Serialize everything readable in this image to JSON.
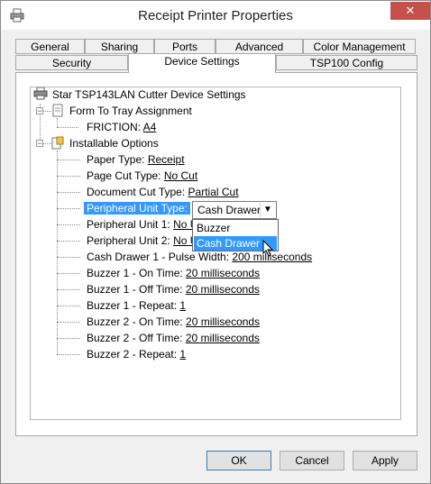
{
  "window": {
    "title": "Receipt Printer Properties",
    "close_label": "✕",
    "icon": "printer-icon"
  },
  "tabs_row1": [
    {
      "label": "General"
    },
    {
      "label": "Sharing"
    },
    {
      "label": "Ports"
    },
    {
      "label": "Advanced"
    },
    {
      "label": "Color Management"
    }
  ],
  "tabs_row2": [
    {
      "label": "Security"
    },
    {
      "label": "Device Settings",
      "selected": true
    },
    {
      "label": "TSP100 Config"
    }
  ],
  "tree": {
    "root": "Star TSP143LAN Cutter Device Settings",
    "form_tray": "Form To Tray Assignment",
    "friction_label": "FRICTION:",
    "friction_value": "A4",
    "installable": "Installable Options",
    "options": [
      {
        "label": "Paper Type:",
        "value": "Receipt"
      },
      {
        "label": "Page Cut Type:",
        "value": "No Cut"
      },
      {
        "label": "Document Cut Type:",
        "value": "Partial Cut"
      },
      {
        "label": "Peripheral Unit Type:",
        "value": ""
      },
      {
        "label": "Peripheral Unit 1:",
        "value": "No U"
      },
      {
        "label": "Peripheral Unit 2:",
        "value": "No U"
      },
      {
        "label": "Cash Drawer 1 - Pulse Width:",
        "value": "200 milliseconds"
      },
      {
        "label": "Buzzer 1 - On Time:",
        "value": "20 milliseconds"
      },
      {
        "label": "Buzzer 1 - Off Time:",
        "value": "20 milliseconds"
      },
      {
        "label": "Buzzer 1 - Repeat:",
        "value": "1"
      },
      {
        "label": "Buzzer 2 - On Time:",
        "value": "20 milliseconds"
      },
      {
        "label": "Buzzer 2 - Off Time:",
        "value": "20 milliseconds"
      },
      {
        "label": "Buzzer 2 - Repeat:",
        "value": "1"
      }
    ]
  },
  "combo": {
    "selected": "Cash Drawer",
    "options": [
      {
        "label": "Buzzer"
      },
      {
        "label": "Cash Drawer",
        "highlighted": true
      }
    ]
  },
  "buttons": {
    "ok": "OK",
    "cancel": "Cancel",
    "apply": "Apply"
  },
  "colors": {
    "selection": "#3399ff",
    "close": "#c7504a"
  }
}
